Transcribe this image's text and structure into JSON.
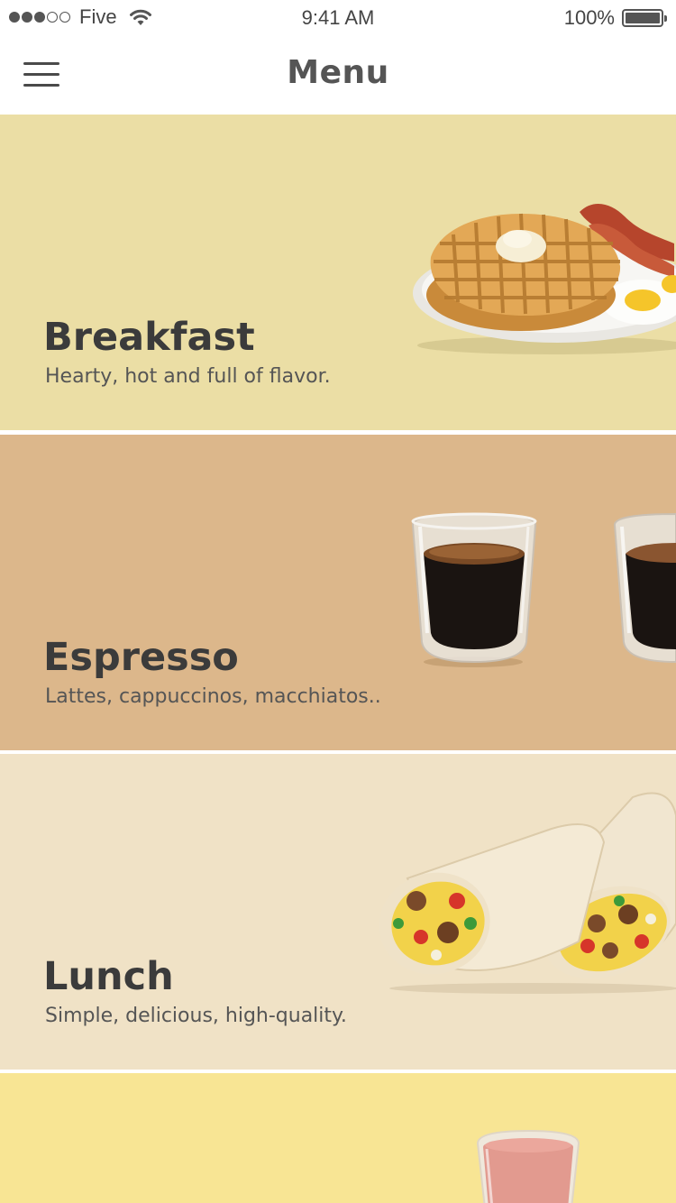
{
  "status_bar": {
    "carrier": "Five",
    "time": "9:41 AM",
    "battery": "100%"
  },
  "nav": {
    "title": "Menu",
    "menu_icon": "hamburger-icon"
  },
  "categories": [
    {
      "title": "Breakfast",
      "subtitle": "Hearty, hot and full of flavor.",
      "color": "#ebdea5"
    },
    {
      "title": "Espresso",
      "subtitle": "Lattes, cappuccinos, macchiatos..",
      "color": "#dcb78b"
    },
    {
      "title": "Lunch",
      "subtitle": "Simple, delicious, high-quality.",
      "color": "#f0e2c6"
    },
    {
      "title": "",
      "subtitle": "",
      "color": "#f8e594"
    }
  ]
}
